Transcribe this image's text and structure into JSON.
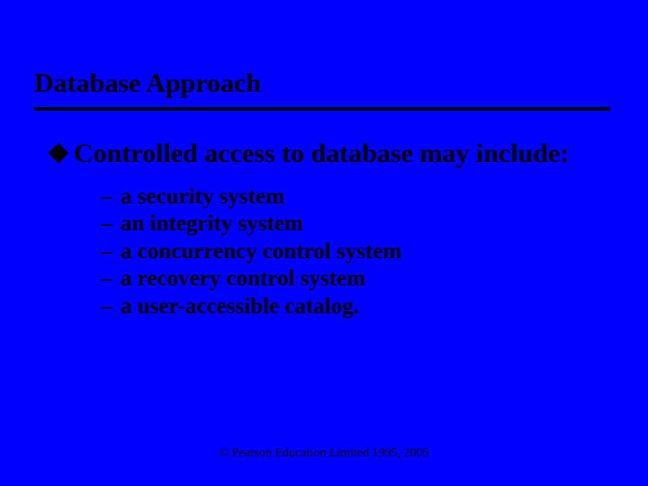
{
  "slide": {
    "title": "Database Approach",
    "main_bullet": "Controlled access to database may include:",
    "sub_bullets": [
      "a security system",
      "an integrity system",
      "a concurrency control system",
      "a recovery control system",
      "a user-accessible catalog."
    ],
    "footer": "© Pearson Education Limited 1995, 2005"
  }
}
